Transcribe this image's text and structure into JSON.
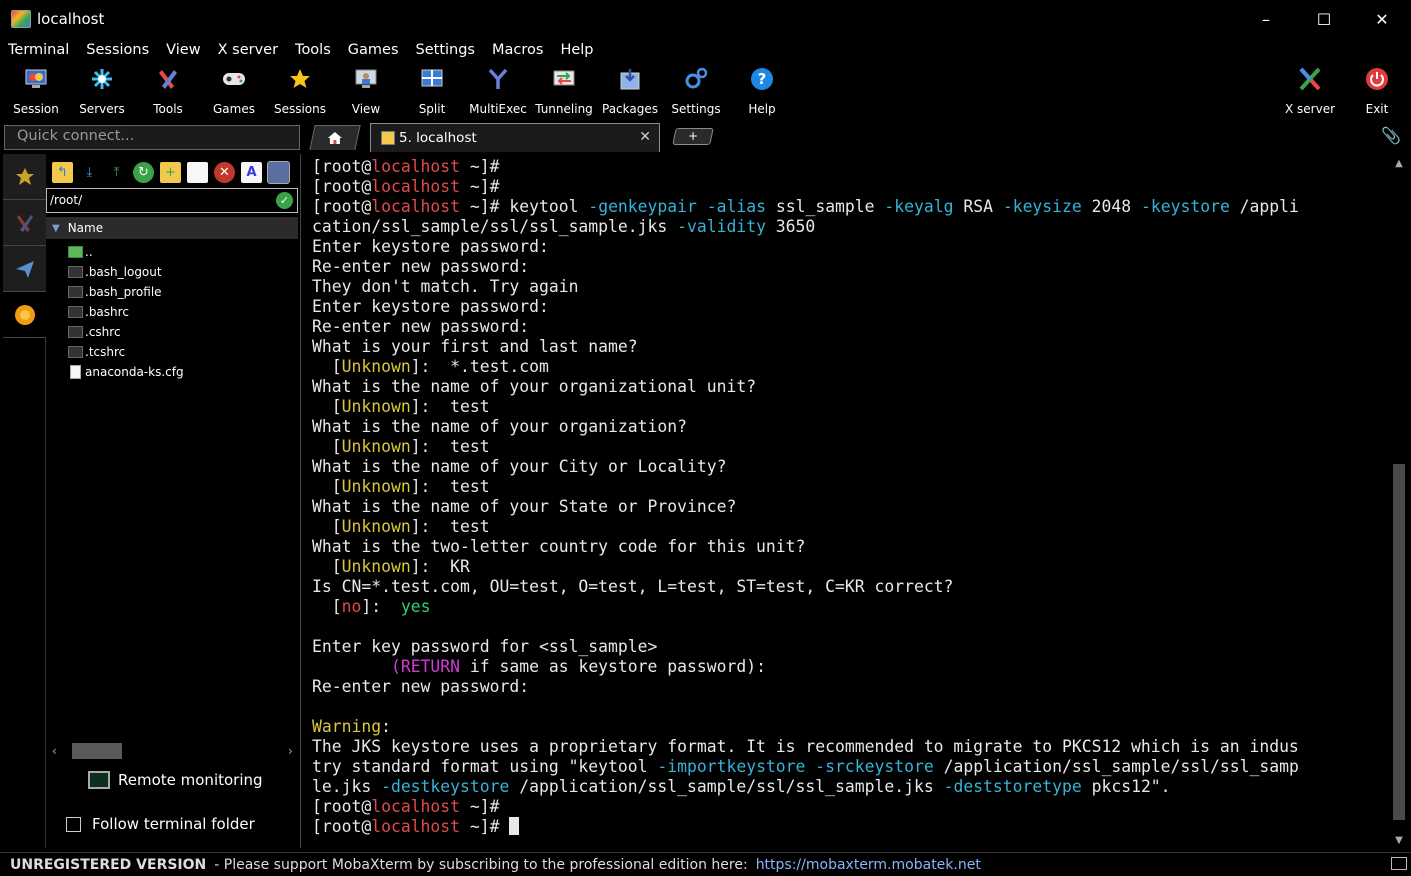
{
  "window": {
    "title": "localhost",
    "minimize": "–",
    "maximize": "☐",
    "close": "✕"
  },
  "menu": [
    "Terminal",
    "Sessions",
    "View",
    "X server",
    "Tools",
    "Games",
    "Settings",
    "Macros",
    "Help"
  ],
  "toolbar": {
    "left": [
      {
        "label": "Session",
        "icon": "session-icon"
      },
      {
        "label": "Servers",
        "icon": "servers-icon"
      },
      {
        "label": "Tools",
        "icon": "tools-icon"
      },
      {
        "label": "Games",
        "icon": "games-icon"
      },
      {
        "label": "Sessions",
        "icon": "star-icon"
      },
      {
        "label": "View",
        "icon": "view-icon"
      },
      {
        "label": "Split",
        "icon": "split-icon"
      },
      {
        "label": "MultiExec",
        "icon": "multiexec-icon"
      },
      {
        "label": "Tunneling",
        "icon": "tunneling-icon"
      },
      {
        "label": "Packages",
        "icon": "packages-icon"
      },
      {
        "label": "Settings",
        "icon": "settings-icon"
      },
      {
        "label": "Help",
        "icon": "help-icon"
      }
    ],
    "right": [
      {
        "label": "X server",
        "icon": "xserver-icon"
      },
      {
        "label": "Exit",
        "icon": "exit-icon"
      }
    ]
  },
  "quick_connect": {
    "placeholder": "Quick connect..."
  },
  "tabs": {
    "session_title": "5. localhost",
    "new_tab": "+",
    "close": "✕"
  },
  "sidebar": {
    "path": "/root/",
    "column": "Name",
    "files": [
      "..",
      ".bash_logout",
      ".bash_profile",
      ".bashrc",
      ".cshrc",
      ".tcshrc",
      "anaconda-ks.cfg"
    ],
    "remote_monitoring": "Remote monitoring",
    "follow_folder": "Follow terminal folder"
  },
  "terminal": {
    "lines": [
      [
        {
          "t": "[root@"
        },
        {
          "t": "localhost",
          "c": "red"
        },
        {
          "t": " ~]#"
        }
      ],
      [
        {
          "t": "[root@"
        },
        {
          "t": "localhost",
          "c": "red"
        },
        {
          "t": " ~]#"
        }
      ],
      [
        {
          "t": "[root@"
        },
        {
          "t": "localhost",
          "c": "red"
        },
        {
          "t": " ~]# keytool "
        },
        {
          "t": "-genkeypair",
          "c": "cyan"
        },
        {
          "t": " "
        },
        {
          "t": "-alias",
          "c": "cyan"
        },
        {
          "t": " ssl_sample "
        },
        {
          "t": "-keyalg",
          "c": "cyan"
        },
        {
          "t": " RSA "
        },
        {
          "t": "-keysize",
          "c": "cyan"
        },
        {
          "t": " 2048 "
        },
        {
          "t": "-keystore",
          "c": "cyan"
        },
        {
          "t": " /appli"
        }
      ],
      [
        {
          "t": "cation/ssl_sample/ssl/ssl_sample.jks "
        },
        {
          "t": "-validity",
          "c": "cyan"
        },
        {
          "t": " 3650"
        }
      ],
      [
        {
          "t": "Enter keystore password:"
        }
      ],
      [
        {
          "t": "Re-enter new password:"
        }
      ],
      [
        {
          "t": "They don't match. Try again"
        }
      ],
      [
        {
          "t": "Enter keystore password:"
        }
      ],
      [
        {
          "t": "Re-enter new password:"
        }
      ],
      [
        {
          "t": "What is your first and last name?"
        }
      ],
      [
        {
          "t": "  ["
        },
        {
          "t": "Unknown",
          "c": "yellow"
        },
        {
          "t": "]:  *.test.com"
        }
      ],
      [
        {
          "t": "What is the name of your organizational unit?"
        }
      ],
      [
        {
          "t": "  ["
        },
        {
          "t": "Unknown",
          "c": "yellow"
        },
        {
          "t": "]:  test"
        }
      ],
      [
        {
          "t": "What is the name of your organization?"
        }
      ],
      [
        {
          "t": "  ["
        },
        {
          "t": "Unknown",
          "c": "yellow"
        },
        {
          "t": "]:  test"
        }
      ],
      [
        {
          "t": "What is the name of your City or Locality?"
        }
      ],
      [
        {
          "t": "  ["
        },
        {
          "t": "Unknown",
          "c": "yellow"
        },
        {
          "t": "]:  test"
        }
      ],
      [
        {
          "t": "What is the name of your State or Province?"
        }
      ],
      [
        {
          "t": "  ["
        },
        {
          "t": "Unknown",
          "c": "yellow"
        },
        {
          "t": "]:  test"
        }
      ],
      [
        {
          "t": "What is the two-letter country code for this unit?"
        }
      ],
      [
        {
          "t": "  ["
        },
        {
          "t": "Unknown",
          "c": "yellow"
        },
        {
          "t": "]:  KR"
        }
      ],
      [
        {
          "t": "Is CN=*.test.com, OU=test, O=test, L=test, ST=test, C=KR correct?"
        }
      ],
      [
        {
          "t": "  ["
        },
        {
          "t": "no",
          "c": "red"
        },
        {
          "t": "]:  "
        },
        {
          "t": "yes",
          "c": "green"
        }
      ],
      [
        {
          "t": ""
        }
      ],
      [
        {
          "t": "Enter key password for <ssl_sample>"
        }
      ],
      [
        {
          "t": "        "
        },
        {
          "t": "(RETURN",
          "c": "mag"
        },
        {
          "t": " if same as keystore password):"
        }
      ],
      [
        {
          "t": "Re-enter new password:"
        }
      ],
      [
        {
          "t": ""
        }
      ],
      [
        {
          "t": "Warning",
          "c": "yellow"
        },
        {
          "t": ":"
        }
      ],
      [
        {
          "t": "The JKS keystore uses a proprietary format. It is recommended to migrate to PKCS12 which is an indus"
        }
      ],
      [
        {
          "t": "try standard format using \"keytool "
        },
        {
          "t": "-importkeystore",
          "c": "cyan"
        },
        {
          "t": " "
        },
        {
          "t": "-srckeystore",
          "c": "cyan"
        },
        {
          "t": " /application/ssl_sample/ssl/ssl_samp"
        }
      ],
      [
        {
          "t": "le.jks "
        },
        {
          "t": "-destkeystore",
          "c": "cyan"
        },
        {
          "t": " /application/ssl_sample/ssl/ssl_sample.jks "
        },
        {
          "t": "-deststoretype",
          "c": "cyan"
        },
        {
          "t": " pkcs12\"."
        }
      ],
      [
        {
          "t": "[root@"
        },
        {
          "t": "localhost",
          "c": "red"
        },
        {
          "t": " ~]#"
        }
      ],
      [
        {
          "t": "[root@"
        },
        {
          "t": "localhost",
          "c": "red"
        },
        {
          "t": " ~]# "
        },
        {
          "cursor": true
        }
      ]
    ]
  },
  "status": {
    "label": "UNREGISTERED VERSION",
    "message": "-  Please support MobaXterm by subscribing to the professional edition here:",
    "link": "https://mobaxterm.mobatek.net"
  },
  "colors": {
    "red": "#e04a4a",
    "cyan": "#35b3d8",
    "yellow": "#d9c73c",
    "green": "#2fd36a",
    "magenta": "#d33ad3"
  }
}
